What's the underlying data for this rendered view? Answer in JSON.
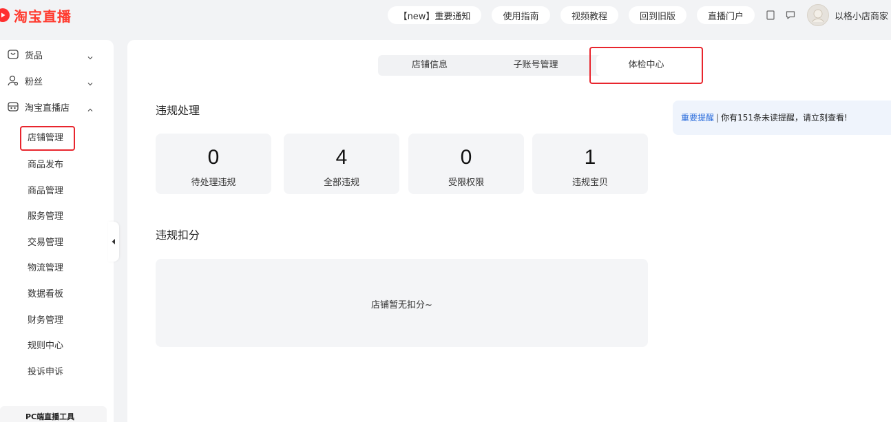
{
  "header": {
    "logo_text": "淘宝直播",
    "nav_buttons": [
      "【new】重要通知",
      "使用指南",
      "视频教程",
      "回到旧版",
      "直播门户"
    ],
    "user_name": "以格小店商家"
  },
  "sidebar": {
    "groups": [
      {
        "label": "货品",
        "icon": "goods-icon",
        "expanded": false
      },
      {
        "label": "粉丝",
        "icon": "fans-icon",
        "expanded": false
      },
      {
        "label": "淘宝直播店",
        "icon": "shop-icon",
        "expanded": true
      }
    ],
    "items": [
      "店铺管理",
      "商品发布",
      "商品管理",
      "服务管理",
      "交易管理",
      "物流管理",
      "数据看板",
      "财务管理",
      "规则中心",
      "投诉申诉"
    ],
    "active_item": "店铺管理",
    "pc_tool_label": "PC端直播工具"
  },
  "tabs": {
    "items": [
      "店铺信息",
      "子账号管理",
      "体检中心"
    ],
    "active": "体检中心"
  },
  "violations": {
    "title": "违规处理",
    "stats": [
      {
        "value": "0",
        "label": "待处理违规"
      },
      {
        "value": "4",
        "label": "全部违规"
      },
      {
        "value": "0",
        "label": "受限权限"
      },
      {
        "value": "1",
        "label": "违规宝贝"
      }
    ]
  },
  "deductions": {
    "title": "违规扣分",
    "empty_text": "店铺暂无扣分~"
  },
  "notice": {
    "link_text": "重要提醒",
    "separator": "|",
    "message": "你有151条未读提醒，请立刻查看!"
  },
  "colors": {
    "brand": "#ff3a2e",
    "highlight_border": "#e8252d",
    "link": "#2f6fdc"
  }
}
